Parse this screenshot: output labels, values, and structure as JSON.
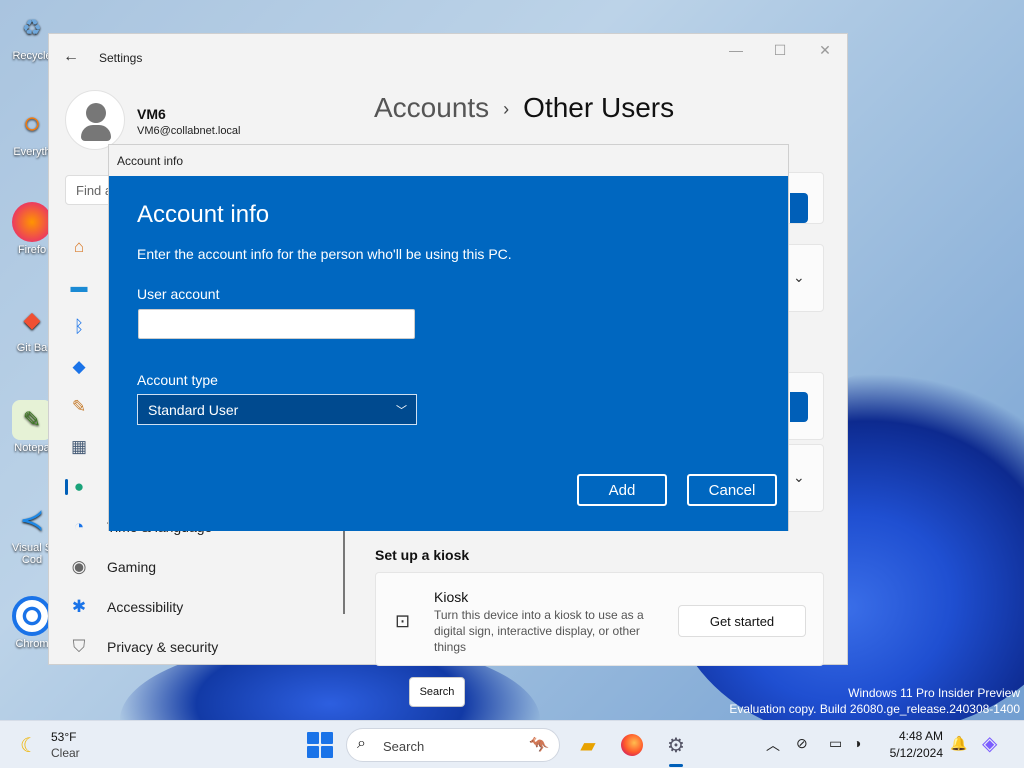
{
  "desktop": {
    "icons": [
      {
        "label": "Recycle",
        "icon": "recycle-bin-icon"
      },
      {
        "label": "Everyth",
        "icon": "everything-search-icon"
      },
      {
        "label": "Firefo",
        "icon": "firefox-icon"
      },
      {
        "label": "Git Ba",
        "icon": "git-bash-icon"
      },
      {
        "label": "Notepa",
        "icon": "notepad-icon"
      },
      {
        "label": "Visual S\nCod",
        "icon": "vscode-icon"
      },
      {
        "label": "Chrom",
        "icon": "chrome-icon"
      }
    ]
  },
  "settings": {
    "app_title": "Settings",
    "user": {
      "name": "VM6",
      "email": "VM6@collabnet.local"
    },
    "find_placeholder": "Find a",
    "breadcrumb": {
      "parent": "Accounts",
      "separator": "›",
      "current": "Other Users"
    },
    "nav": [
      {
        "label": "",
        "icon": "home-icon"
      },
      {
        "label": "",
        "icon": "system-icon"
      },
      {
        "label": "",
        "icon": "bluetooth-icon"
      },
      {
        "label": "",
        "icon": "network-icon"
      },
      {
        "label": "",
        "icon": "personalization-icon"
      },
      {
        "label": "",
        "icon": "apps-icon"
      },
      {
        "label": "",
        "icon": "accounts-icon",
        "active": true
      },
      {
        "label": "Time & language",
        "icon": "time-language-icon"
      },
      {
        "label": "Gaming",
        "icon": "gaming-icon"
      },
      {
        "label": "Accessibility",
        "icon": "accessibility-icon"
      },
      {
        "label": "Privacy & security",
        "icon": "privacy-shield-icon"
      }
    ],
    "kiosk_section": {
      "heading": "Set up a kiosk",
      "title": "Kiosk",
      "description": "Turn this device into a kiosk to use as a digital sign, interactive display, or other things",
      "button": "Get started"
    }
  },
  "dialog": {
    "window_title": "Account info",
    "heading": "Account info",
    "subtitle": "Enter the account info for the person who'll be using this PC.",
    "user_account_label": "User account",
    "user_account_value": "",
    "account_type_label": "Account type",
    "account_type_value": "Standard User",
    "add_label": "Add",
    "cancel_label": "Cancel"
  },
  "tooltip": {
    "text": "Search"
  },
  "watermark": {
    "line1": "Windows 11 Pro Insider Preview",
    "line2": "Evaluation copy. Build 26080.ge_release.240308-1400"
  },
  "taskbar": {
    "weather": {
      "temp": "53°F",
      "condition": "Clear"
    },
    "search_label": "Search",
    "clock": {
      "time": "4:48 AM",
      "date": "5/12/2024"
    }
  },
  "colors": {
    "accent": "#0067c0",
    "dialog_select_bg": "#004a8f"
  }
}
